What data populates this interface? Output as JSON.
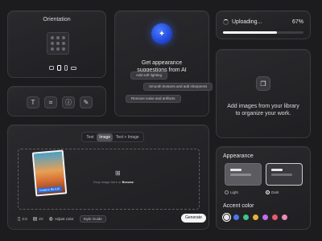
{
  "orientation": {
    "title": "Orientation"
  },
  "tools": {
    "icons": [
      "text-icon",
      "crop-icon",
      "info-icon",
      "eraser-icon"
    ]
  },
  "ai": {
    "title_line1": "Get appearance",
    "title_line2": "suggestions from AI",
    "suggestions": [
      "Add soft lighting",
      "Smooth textures and add sharpness",
      "Remove noise and artifacts"
    ]
  },
  "upload": {
    "label": "Uploading...",
    "percent_text": "67%",
    "percent": 67
  },
  "library": {
    "line1": "Add images from your library",
    "line2": "to organize your work."
  },
  "editor": {
    "tabs": [
      "Text",
      "Image",
      "Text + Image"
    ],
    "active_tab": "Image",
    "thumb_label": "Creative file 016",
    "drop_prefix": "Drop image here or ",
    "drop_link": "Browse",
    "toolbar": {
      "ratio": "2:3",
      "count": "2V",
      "adjust": "Adjust color",
      "style": "Style Guide"
    },
    "generate": "Generate"
  },
  "appearance": {
    "title": "Appearance",
    "light_label": "Light",
    "dark_label": "Dark",
    "selected": "Dark",
    "accent_title": "Accent color",
    "accent_colors": [
      "#e8e8ea",
      "#4a78f0",
      "#3dc58a",
      "#e8b13c",
      "#c56bf0",
      "#e85b6e",
      "#f08ab5"
    ]
  }
}
